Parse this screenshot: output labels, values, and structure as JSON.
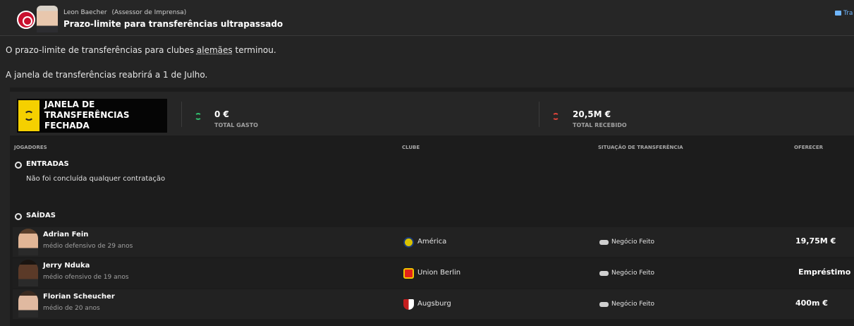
{
  "header": {
    "sender_name": "Leon Baecher",
    "sender_role": "(Assessor de Imprensa)",
    "subject": "Prazo-limite para transferências ultrapassado",
    "tag_link": "Tra"
  },
  "message": {
    "line1_before": "O prazo-limite de transferências para clubes ",
    "line1_underlined": "alemães",
    "line1_after": " terminou.",
    "line2": "A janela de transferências reabrirá a 1 de Julho."
  },
  "summary": {
    "status_label": "Janela de Transferências Fechada",
    "spent_value": "0 €",
    "spent_label": "Total Gasto",
    "received_value": "20,5M €",
    "received_label": "Total Recebido"
  },
  "columns": {
    "players": "Jogadores",
    "club": "Clube",
    "status": "Situação de Transferência",
    "offer": "Oferecer"
  },
  "entradas": {
    "title": "ENTRADAS",
    "empty_message": "Não foi concluída qualquer contratação"
  },
  "saidas": {
    "title": "SAÍDAS",
    "rows": [
      {
        "name": "Adrian Fein",
        "desc": "médio defensivo de 29 anos",
        "club": "América",
        "status": "Negócio Feito",
        "offer": "19,75M €"
      },
      {
        "name": "Jerry Nduka",
        "desc": "médio ofensivo de 19 anos",
        "club": "Union Berlin",
        "status": "Negócio Feito",
        "offer": "Empréstimo"
      },
      {
        "name": "Florian Scheucher",
        "desc": "médio de 20 anos",
        "club": "Augsburg",
        "status": "Negócio Feito",
        "offer": "400m €"
      }
    ]
  },
  "colors": {
    "status_yellow": "#f5d000",
    "incoming_green": "#32c06f",
    "outgoing_red": "#e0443a",
    "link_blue": "#6fb6ff"
  }
}
